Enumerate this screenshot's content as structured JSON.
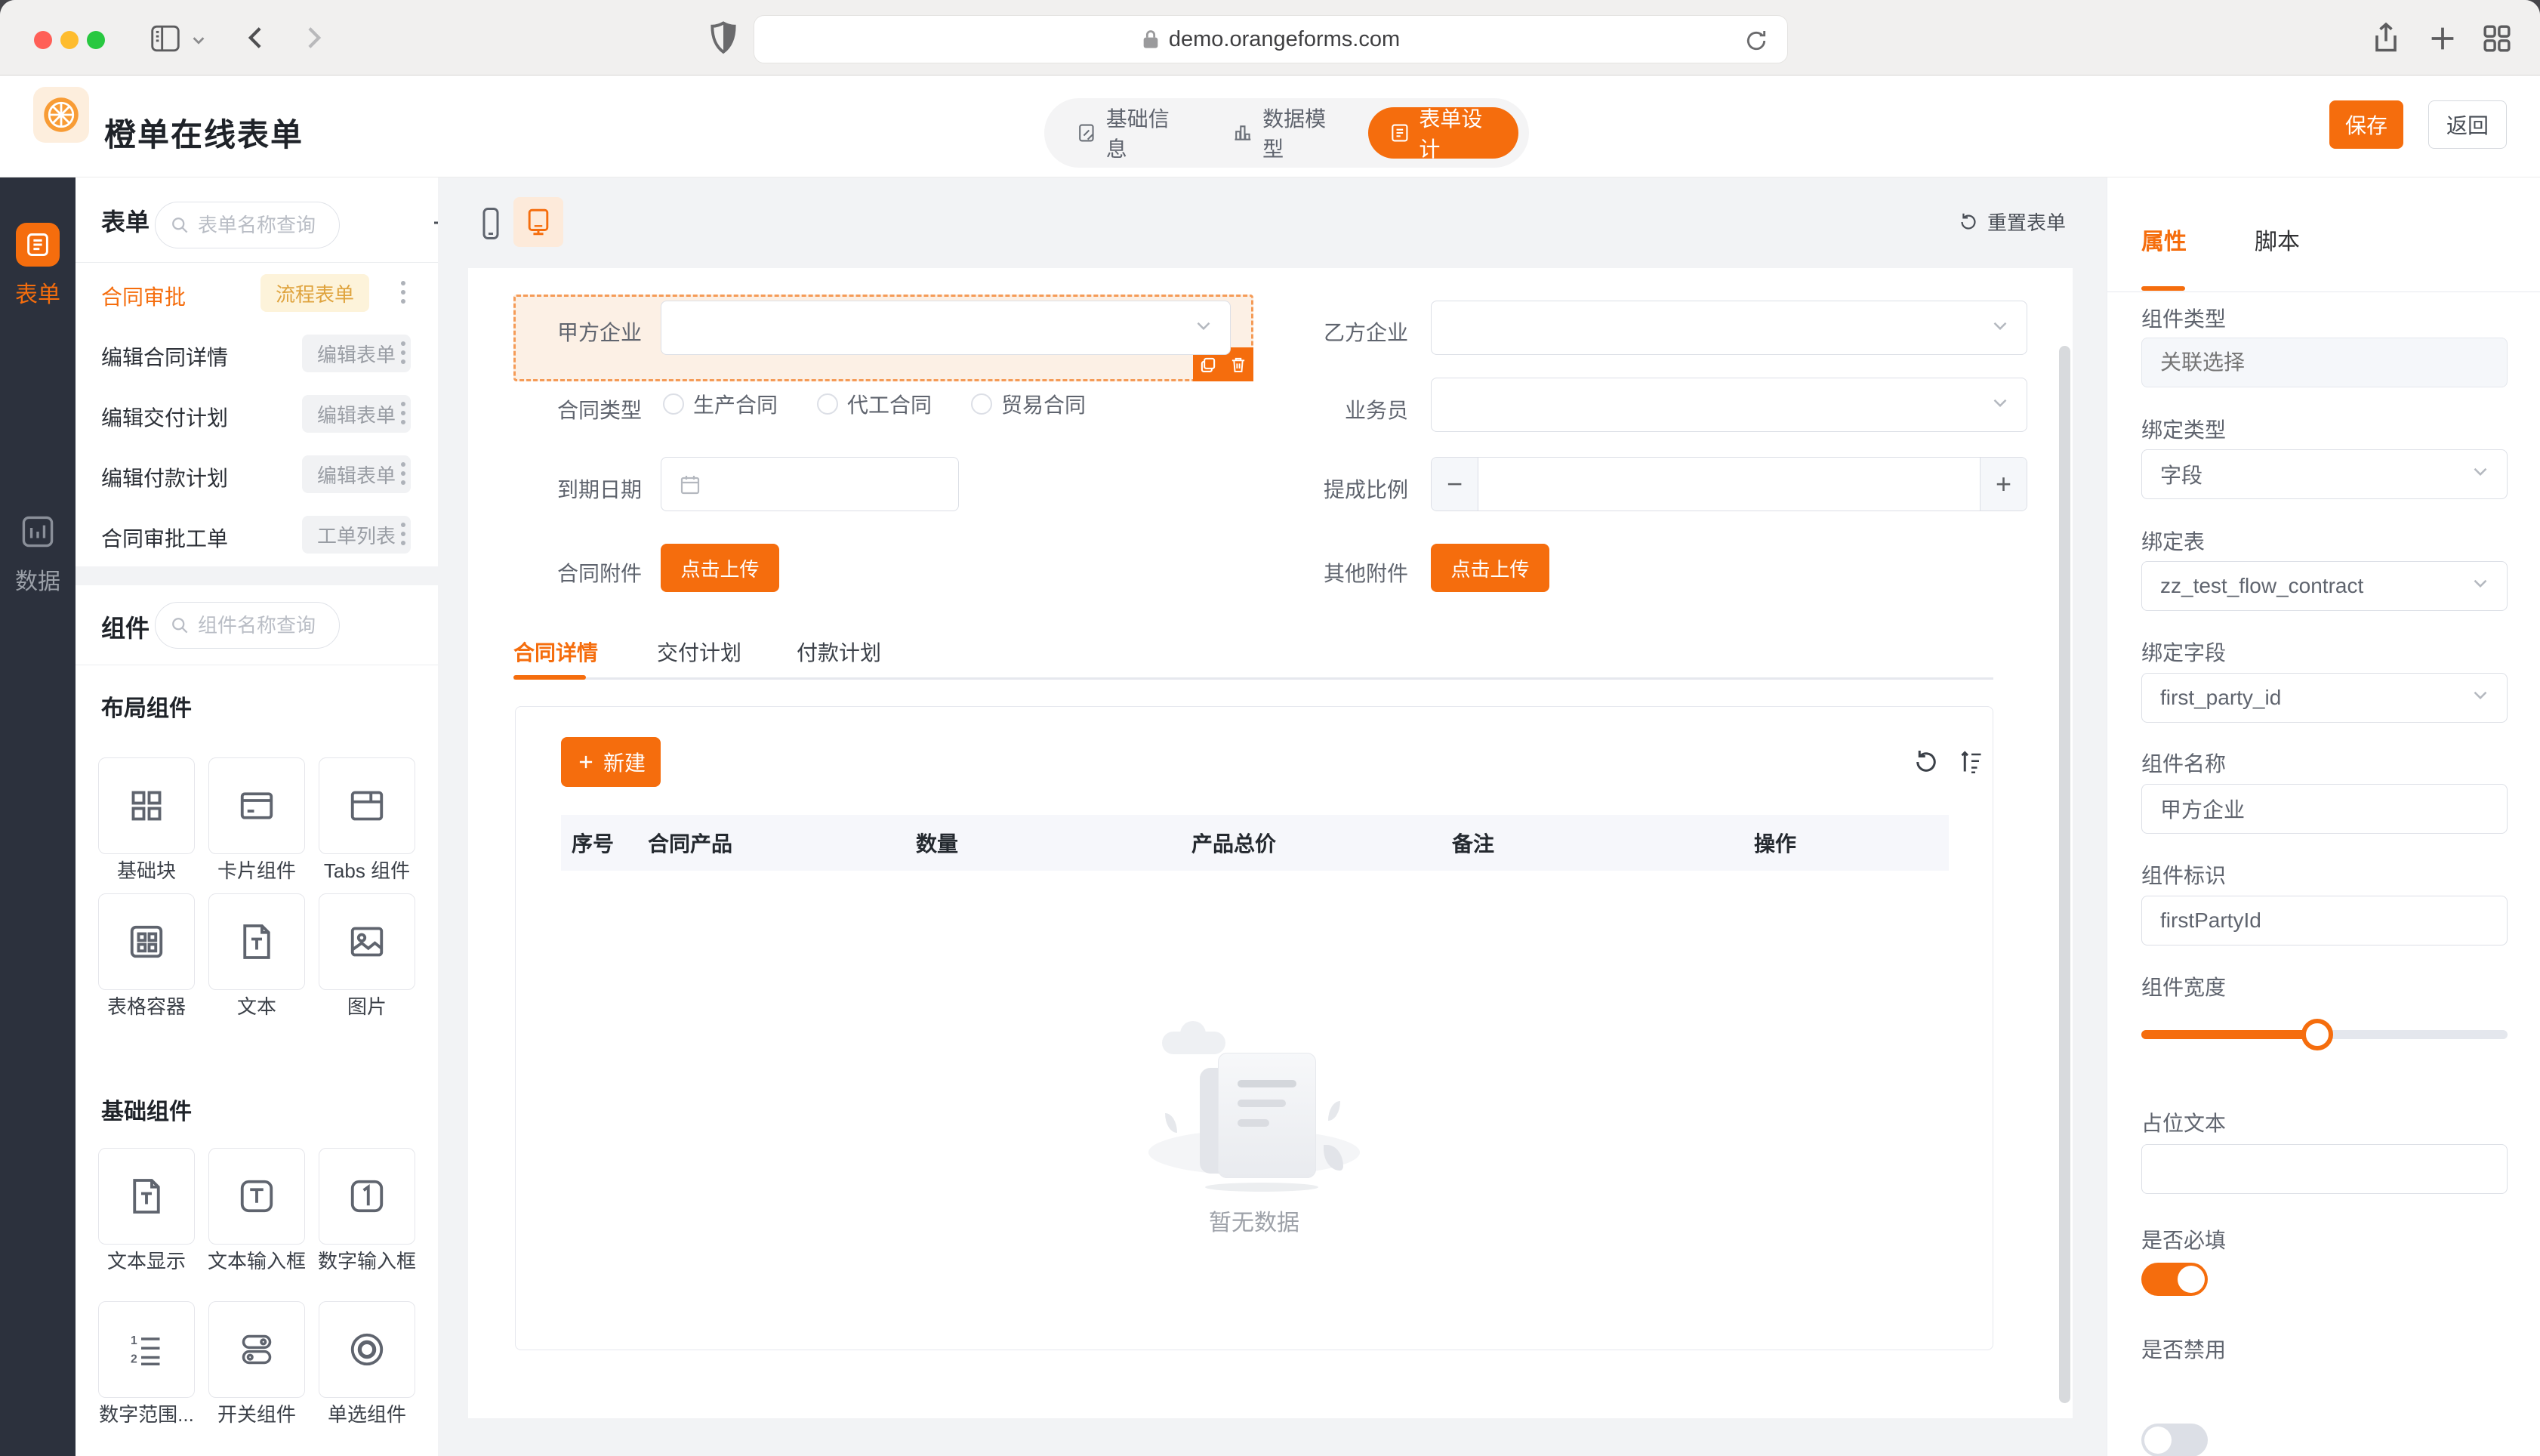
{
  "colors": {
    "primary": "#f56d0d",
    "rail_bg": "#2c313d",
    "warn_badge_bg": "#fdf3da",
    "warn_badge_text": "#dfa33d",
    "canvas_bg": "#f2f3f5"
  },
  "browser": {
    "url": "demo.orangeforms.com"
  },
  "header": {
    "app_title": "橙单在线表单",
    "tabs": [
      {
        "label": "基础信息"
      },
      {
        "label": "数据模型"
      },
      {
        "label": "表单设计"
      }
    ],
    "save_label": "保存",
    "back_label": "返回"
  },
  "rail": {
    "items": [
      {
        "label": "表单"
      },
      {
        "label": "数据"
      }
    ]
  },
  "forms_panel": {
    "title": "表单",
    "search_placeholder": "表单名称查询",
    "items": [
      {
        "name": "合同审批",
        "badge": "流程表单"
      },
      {
        "name": "编辑合同详情",
        "badge": "编辑表单"
      },
      {
        "name": "编辑交付计划",
        "badge": "编辑表单"
      },
      {
        "name": "编辑付款计划",
        "badge": "编辑表单"
      },
      {
        "name": "合同审批工单",
        "badge": "工单列表"
      }
    ]
  },
  "components_panel": {
    "title": "组件",
    "search_placeholder": "组件名称查询",
    "layout_group_title": "布局组件",
    "layout_items": [
      "基础块",
      "卡片组件",
      "Tabs 组件",
      "表格容器",
      "文本",
      "图片"
    ],
    "basic_group_title": "基础组件",
    "basic_items": [
      "文本显示",
      "文本输入框",
      "数字输入框",
      "数字范围...",
      "开关组件",
      "单选组件"
    ]
  },
  "canvas": {
    "reset_label": "重置表单",
    "fields": {
      "first_party": "甲方企业",
      "second_party": "乙方企业",
      "contract_type": "合同类型",
      "salesman": "业务员",
      "due_date": "到期日期",
      "commission": "提成比例",
      "contract_attachment": "合同附件",
      "other_attachment": "其他附件"
    },
    "radio_options": [
      "生产合同",
      "代工合同",
      "贸易合同"
    ],
    "upload_label": "点击上传",
    "detail_tabs": [
      "合同详情",
      "交付计划",
      "付款计划"
    ],
    "create_label": "新建",
    "table_headers": [
      "序号",
      "合同产品",
      "数量",
      "产品总价",
      "备注",
      "操作"
    ],
    "empty_text": "暂无数据"
  },
  "props_panel": {
    "tab_props": "属性",
    "tab_script": "脚本",
    "component_type_label": "组件类型",
    "component_type_placeholder": "关联选择",
    "bind_type_label": "绑定类型",
    "bind_type_value": "字段",
    "bind_table_label": "绑定表",
    "bind_table_value": "zz_test_flow_contract",
    "bind_field_label": "绑定字段",
    "bind_field_value": "first_party_id",
    "component_name_label": "组件名称",
    "component_name_value": "甲方企业",
    "component_id_label": "组件标识",
    "component_id_value": "firstPartyId",
    "component_width_label": "组件宽度",
    "component_width_percent": 48,
    "placeholder_label": "占位文本",
    "placeholder_value": "",
    "required_label": "是否必填",
    "required_on": true,
    "disabled_label": "是否禁用",
    "disabled_on": false
  }
}
